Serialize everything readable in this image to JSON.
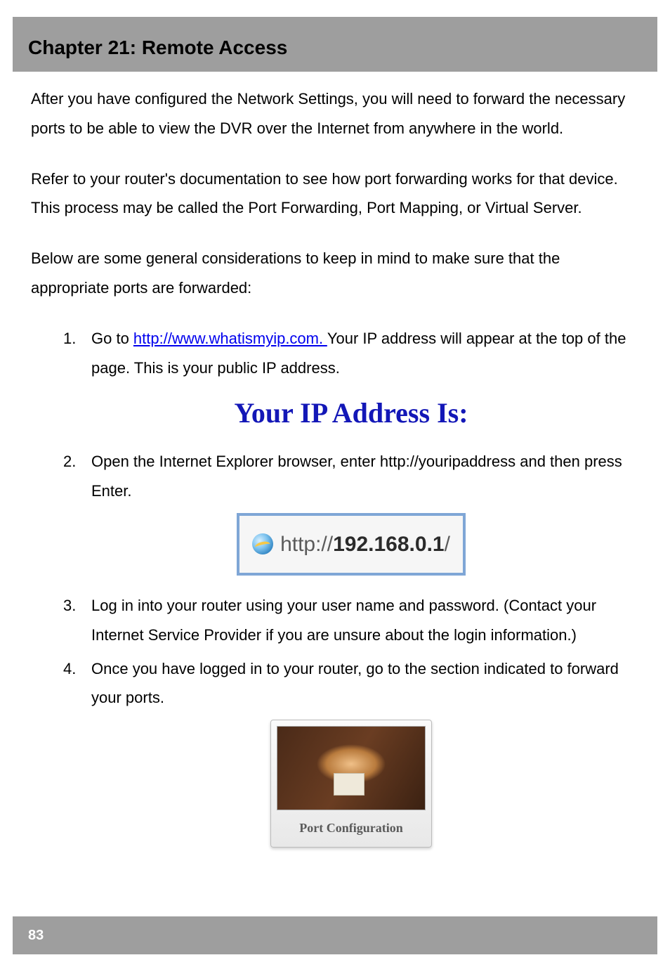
{
  "header": {
    "title": "Chapter 21: Remote Access"
  },
  "body": {
    "p1": "After you have configured the Network Settings, you will need to forward the necessary ports to be able to view the DVR over the Internet from anywhere in the world.",
    "p2": "Refer to your router's documentation to see how port forwarding works for that device. This process may be called the Port Forwarding, Port Mapping, or Virtual Server.",
    "p3": "Below are some general considerations to keep in mind to make sure that the appropriate ports are forwarded:",
    "list": [
      {
        "num": "1.",
        "pre": "Go to ",
        "link": "http://www.whatismyip.com. ",
        "post": "Your IP address will appear at the top of the page. This is your public IP address."
      },
      {
        "num": "2.",
        "text": "Open the Internet Explorer browser, enter http://youripaddress and then press Enter."
      },
      {
        "num": "3.",
        "text": "Log in into your router using your user name and password. (Contact your Internet Service Provider if you are unsure about the login information.)"
      },
      {
        "num": "4.",
        "text": "Once you have logged in to your router, go to the section indicated to forward your ports."
      }
    ]
  },
  "figures": {
    "ip_heading": "Your IP Address Is:",
    "addr_prefix": "http://",
    "addr_ip": "192.168.0.1",
    "addr_suffix": "/",
    "portcfg_caption": "Port Configuration"
  },
  "footer": {
    "page": "83"
  }
}
